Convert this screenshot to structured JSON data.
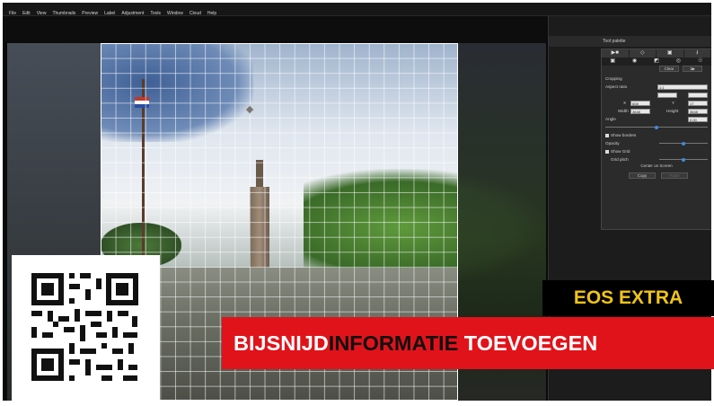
{
  "menu": [
    "File",
    "Edit",
    "View",
    "Thumbnails",
    "Preview",
    "Label",
    "Adjustment",
    "Tools",
    "Window",
    "Cloud",
    "Help"
  ],
  "panel": {
    "title": "Tool palette",
    "top_icons": [
      "▶■",
      "◇",
      "▣",
      "⭳"
    ],
    "sub_icons": [
      "▣",
      "◉",
      "◩",
      "◎",
      "☉"
    ],
    "cropping_label": "Cropping",
    "aspect_label": "Aspect ratio",
    "aspect_value": "1:1",
    "x_label": "X",
    "x_value": "608",
    "y_label": "Y",
    "y_value": "17",
    "width_label": "Width",
    "width_value": "3648",
    "height_label": "Height",
    "height_value": "3648",
    "angle_label": "Angle",
    "angle_value": "0.00",
    "show_borders": "Show borders",
    "opacity_label": "Opacity",
    "show_grid": "Show Grid",
    "grid_pitch": "Grid pitch",
    "center_btn": "Center on Screen",
    "copy_btn": "Copy",
    "paste_btn": "Paste",
    "clear_btn": "Clear",
    "reset_btn": "1▶"
  },
  "overlay": {
    "badge": "EOS EXTRA",
    "title_part1": "BIJSNIJD",
    "title_part2": "INFORMATIE",
    "title_part3": " TOEVOEGEN"
  },
  "sliders": {
    "angle": 0.5,
    "opacity": 0.5,
    "grid_pitch": 0.5
  },
  "colors": {
    "banner_red": "#e0131b",
    "badge_yellow": "#f0c419",
    "accent": "#3f8ce0"
  }
}
